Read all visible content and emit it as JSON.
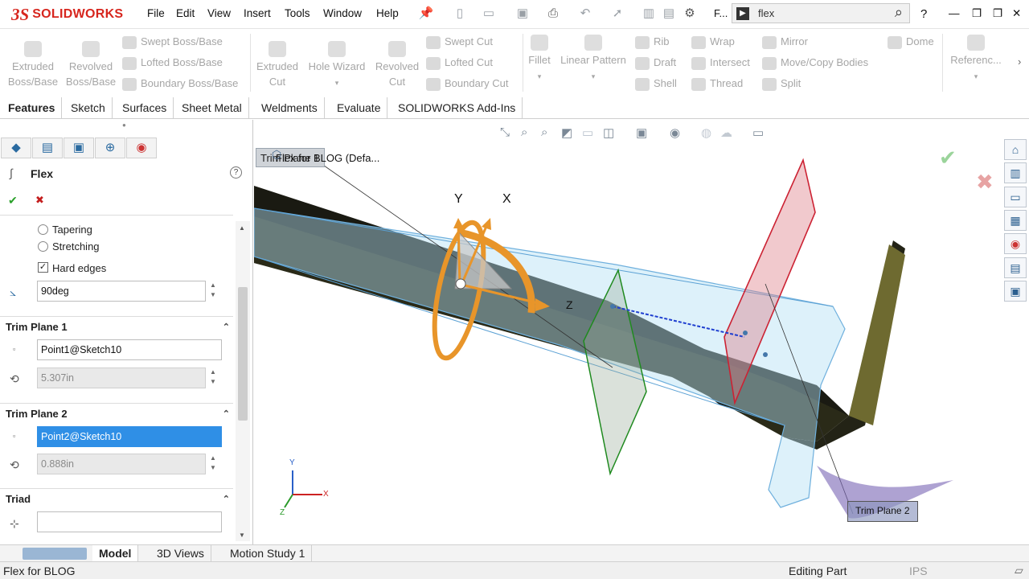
{
  "app": {
    "brand": "SOLIDWORKS",
    "ds_mark": "3S"
  },
  "menu": [
    "File",
    "Edit",
    "View",
    "Insert",
    "Tools",
    "Window",
    "Help"
  ],
  "search": {
    "value": "flex",
    "truncated_label": "F..."
  },
  "window_controls": {
    "help": "?",
    "minimize": "—",
    "restore": "❐",
    "close": "✕"
  },
  "ribbon": {
    "extruded_boss": [
      "Extruded",
      "Boss/Base"
    ],
    "revolved_boss": [
      "Revolved",
      "Boss/Base"
    ],
    "swept_boss": "Swept Boss/Base",
    "lofted_boss": "Lofted Boss/Base",
    "boundary_boss": "Boundary Boss/Base",
    "extruded_cut": [
      "Extruded",
      "Cut"
    ],
    "hole_wizard": "Hole Wizard",
    "revolved_cut": [
      "Revolved",
      "Cut"
    ],
    "swept_cut": "Swept Cut",
    "lofted_cut": "Lofted Cut",
    "boundary_cut": "Boundary Cut",
    "fillet": "Fillet",
    "linear_pattern": "Linear Pattern",
    "rib": "Rib",
    "draft": "Draft",
    "shell": "Shell",
    "wrap": "Wrap",
    "intersect": "Intersect",
    "thread": "Thread",
    "mirror": "Mirror",
    "move_copy": "Move/Copy Bodies",
    "split": "Split",
    "dome": "Dome",
    "reference": "Referenc..."
  },
  "tabs": [
    "Features",
    "Sketch",
    "Surfaces",
    "Sheet Metal",
    "Weldments",
    "Evaluate",
    "SOLIDWORKS Add-Ins"
  ],
  "panel": {
    "title": "Flex",
    "help": "?",
    "ok": "✔",
    "cancel": "✖",
    "options": {
      "tapering": "Tapering",
      "stretching": "Stretching",
      "hard_edges": "Hard edges"
    },
    "angle": "90deg",
    "trim_plane_1": {
      "title": "Trim Plane 1",
      "entity": "Point1@Sketch10",
      "offset": "5.307in"
    },
    "trim_plane_2": {
      "title": "Trim Plane 2",
      "entity": "Point2@Sketch10",
      "offset": "0.888in"
    },
    "triad": {
      "title": "Triad",
      "value": ""
    }
  },
  "viewport": {
    "tree_label": "Flex for BLOG  (Defa...",
    "tree_callout": "Trim Plane 1",
    "callout_plane2": "Trim Plane 2",
    "triad_labels": {
      "y": "Y",
      "x": "X",
      "z": "Z"
    },
    "axis_labels": {
      "x": "X",
      "y": "Y",
      "z": "Z"
    }
  },
  "bottom_tabs": [
    "Model",
    "3D Views",
    "Motion Study 1"
  ],
  "status": {
    "left": "Flex for BLOG",
    "mode": "Editing Part",
    "units": "IPS"
  }
}
